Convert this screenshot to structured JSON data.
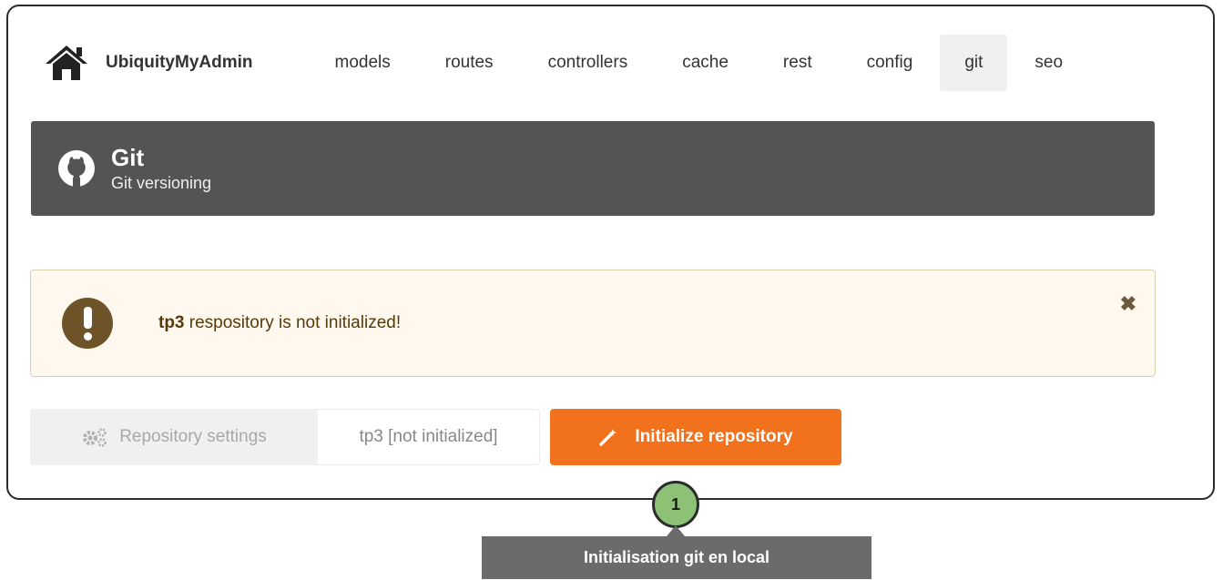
{
  "nav": {
    "brand": "UbiquityMyAdmin",
    "items": [
      {
        "label": "models"
      },
      {
        "label": "routes"
      },
      {
        "label": "controllers"
      },
      {
        "label": "cache"
      },
      {
        "label": "rest"
      },
      {
        "label": "config"
      },
      {
        "label": "git",
        "active": true
      },
      {
        "label": "seo"
      }
    ]
  },
  "header": {
    "icon": "github-icon",
    "title": "Git",
    "subtitle": "Git versioning"
  },
  "warning": {
    "icon": "exclamation-icon",
    "repo": "tp3",
    "message": "respository is not initialized!",
    "close_icon": "close-icon"
  },
  "actions": {
    "settings_label": "Repository settings",
    "repo_status": "tp3 [not initialized]",
    "init_label": "Initialize repository"
  },
  "annotation": {
    "step": "1",
    "text": "Initialisation git en local"
  },
  "colors": {
    "header_bg": "#545454",
    "warning_bg": "#fff8ef",
    "warning_icon": "#6f5328",
    "init_button": "#f2711c",
    "step_circle": "#8dc276",
    "callout_bg": "#6b6b6b"
  }
}
